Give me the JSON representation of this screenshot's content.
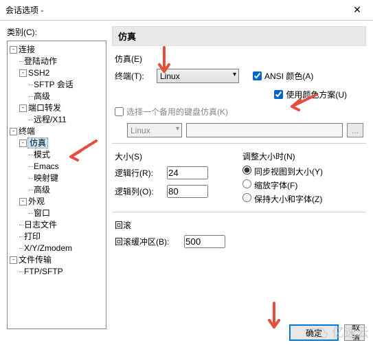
{
  "window": {
    "title": "会话选项 -",
    "close": "✕"
  },
  "category_label": "类别(C):",
  "tree": {
    "connection": "连接",
    "login": "登陆动作",
    "ssh2": "SSH2",
    "sftp": "SFTP 会话",
    "advanced1": "高级",
    "portfwd": "端口转发",
    "remotex11": "远程/X11",
    "terminal": "终端",
    "emulation": "仿真",
    "mode": "模式",
    "emacs": "Emacs",
    "mapkey": "映射键",
    "advanced2": "高级",
    "appearance": "外观",
    "window": "窗口",
    "logfile": "日志文件",
    "print": "打印",
    "xyz": "X/Y/Zmodem",
    "filetrans": "文件传输",
    "ftpsftp": "FTP/SFTP"
  },
  "panel": {
    "title": "仿真",
    "emu_group": "仿真(E)",
    "terminal_label": "终端(T):",
    "terminal_value": "Linux",
    "ansi_color": "ANSI 颜色(A)",
    "color_scheme": "使用颜色方案(U)",
    "alt_keyboard_cb": "选择一个备用的键盘仿真(K)",
    "alt_keyboard_value": "Linux",
    "browse": "...",
    "size_group": "大小(S)",
    "rows_label": "逻辑行(R):",
    "rows_value": "24",
    "cols_label": "逻辑列(O):",
    "cols_value": "80",
    "resize_group": "调整大小时(N)",
    "resize_sync": "同步视图到大小(Y)",
    "resize_zoom": "缩放字体(F)",
    "resize_keep": "保持大小和字体(Z)",
    "scrollback_group": "回滚",
    "scrollback_label": "回滚缓冲区(B):",
    "scrollback_value": "500"
  },
  "buttons": {
    "ok": "确定",
    "cancel": "取消"
  },
  "watermark": "亿速云"
}
